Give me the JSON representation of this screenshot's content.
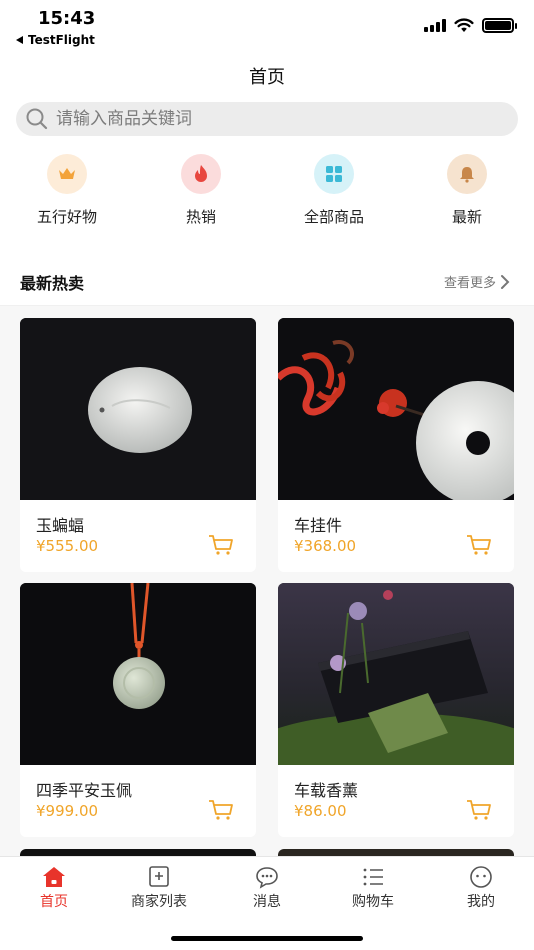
{
  "status_bar": {
    "time": "15:43",
    "back_app": "TestFlight"
  },
  "header": {
    "title": "首页"
  },
  "search": {
    "placeholder": "请输入商品关键词"
  },
  "categories": [
    {
      "label": "五行好物",
      "icon": "crown-icon",
      "color": "#f3a33a"
    },
    {
      "label": "热销",
      "icon": "flame-icon",
      "color": "#e8473f"
    },
    {
      "label": "全部商品",
      "icon": "grid-icon",
      "color": "#3bb9d6"
    },
    {
      "label": "最新",
      "icon": "bell-icon",
      "color": "#c8874a"
    }
  ],
  "section": {
    "title": "最新热卖",
    "more": "查看更多"
  },
  "products": [
    {
      "name": "玉蝙蝠",
      "price": "¥555.00"
    },
    {
      "name": "车挂件",
      "price": "¥368.00"
    },
    {
      "name": "四季平安玉佩",
      "price": "¥999.00"
    },
    {
      "name": "车载香薰",
      "price": "¥86.00"
    }
  ],
  "tabbar": [
    {
      "label": "首页",
      "icon": "home-icon",
      "active": true
    },
    {
      "label": "商家列表",
      "icon": "store-list-icon",
      "active": false
    },
    {
      "label": "消息",
      "icon": "message-icon",
      "active": false
    },
    {
      "label": "购物车",
      "icon": "cart-list-icon",
      "active": false
    },
    {
      "label": "我的",
      "icon": "profile-icon",
      "active": false
    }
  ],
  "colors": {
    "accent": "#e8342b",
    "price": "#f0a52a"
  }
}
